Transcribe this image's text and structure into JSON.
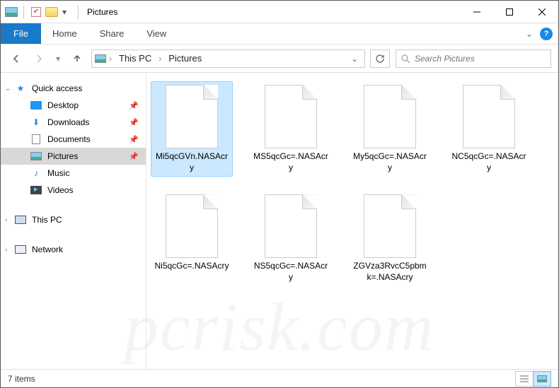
{
  "title": "Pictures",
  "ribbon": {
    "file": "File",
    "tabs": [
      "Home",
      "Share",
      "View"
    ]
  },
  "breadcrumb": {
    "segments": [
      "This PC",
      "Pictures"
    ]
  },
  "search": {
    "placeholder": "Search Pictures"
  },
  "nav": {
    "quick_access": {
      "label": "Quick access",
      "items": [
        {
          "label": "Desktop",
          "icon": "desktop",
          "pinned": true
        },
        {
          "label": "Downloads",
          "icon": "downloads",
          "pinned": true
        },
        {
          "label": "Documents",
          "icon": "documents",
          "pinned": true
        },
        {
          "label": "Pictures",
          "icon": "pictures",
          "pinned": true,
          "active": true
        },
        {
          "label": "Music",
          "icon": "music",
          "pinned": false
        },
        {
          "label": "Videos",
          "icon": "videos",
          "pinned": false
        }
      ]
    },
    "this_pc": {
      "label": "This PC"
    },
    "network": {
      "label": "Network"
    }
  },
  "files": [
    {
      "name": "Mi5qcGVn.NASAcry",
      "selected": true
    },
    {
      "name": "MS5qcGc=.NASAcry",
      "selected": false
    },
    {
      "name": "My5qcGc=.NASAcry",
      "selected": false
    },
    {
      "name": "NC5qcGc=.NASAcry",
      "selected": false
    },
    {
      "name": "Ni5qcGc=.NASAcry",
      "selected": false
    },
    {
      "name": "NS5qcGc=.NASAcry",
      "selected": false
    },
    {
      "name": "ZGVza3RvcC5pbmk=.NASAcry",
      "selected": false
    }
  ],
  "status": {
    "count_label": "7 items"
  },
  "watermark": "pcrisk.com"
}
